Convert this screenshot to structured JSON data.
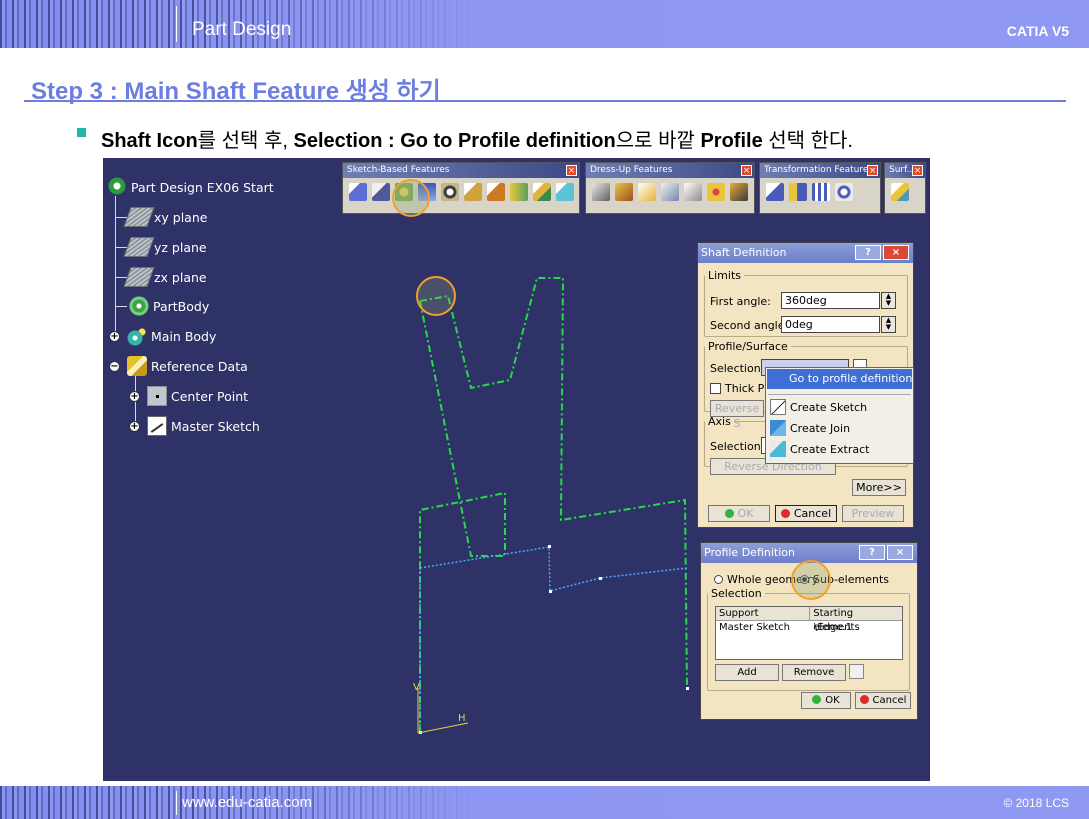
{
  "header": {
    "title": "Part Design",
    "brand": "CATIA V5"
  },
  "step_title": "Step 3 : Main Shaft Feature 생성 하기",
  "instruction": {
    "p1": "Shaft Icon",
    "p2": "를 선택 후, ",
    "p3": "Selection : Go to Profile definition",
    "p4": "으로 바깥 ",
    "p5": "Profile",
    "p6": " 선택 한다."
  },
  "tree": {
    "root": "Part Design EX06 Start",
    "items": [
      "xy plane",
      "yz plane",
      "zx plane",
      "PartBody",
      "Main Body",
      "Reference Data",
      "Center Point",
      "Master Sketch"
    ]
  },
  "toolbars": {
    "sketch_based": "Sketch-Based Features",
    "dress_up": "Dress-Up Features",
    "transformation": "Transformation Features",
    "surface": "Surf..."
  },
  "shaft_dialog": {
    "title": "Shaft Definition",
    "limits": "Limits",
    "first_angle_label": "First angle:",
    "first_angle_value": "360deg",
    "second_angle_label": "Second angle:",
    "second_angle_value": "0deg",
    "profile_surface": "Profile/Surface",
    "selection_label": "Selection:",
    "thick_label": "Thick Pro",
    "reverse_side": "Reverse S",
    "axis": "Axis",
    "axis_selection_label": "Selection:",
    "reverse_direction": "Reverse Direction",
    "more": "More>>",
    "ok": "OK",
    "cancel": "Cancel",
    "preview": "Preview"
  },
  "context_menu": {
    "items": [
      "Go to profile definition",
      "Create Sketch",
      "Create Join",
      "Create Extract"
    ]
  },
  "profile_dialog": {
    "title": "Profile Definition",
    "whole_geometry": "Whole geometry",
    "sub_elements": "Sub-elements",
    "selection": "Selection",
    "col_support": "Support",
    "col_starting": "Starting elements",
    "row_support": "Master Sketch",
    "row_starting": "\\Edge.1",
    "add": "Add",
    "remove": "Remove",
    "ok": "OK",
    "cancel": "Cancel"
  },
  "axis_labels": {
    "v": "V",
    "h": "H"
  },
  "footer": {
    "url": "www.edu-catia.com",
    "copyright": "© 2018 LCS"
  },
  "colors": {
    "accent": "#6c7ee0",
    "bar": "#8f98f3",
    "canvas": "#2e3266",
    "profile_green": "#27d84a",
    "highlight": "#3f6ed4",
    "annotation": "#f2a02a"
  }
}
